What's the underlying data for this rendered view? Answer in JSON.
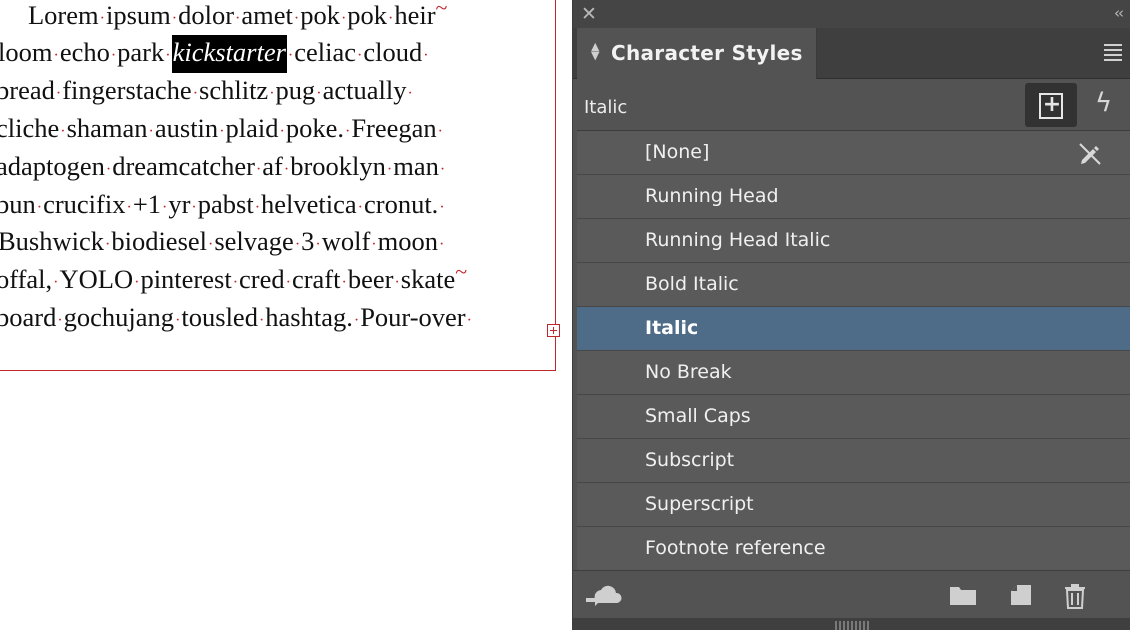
{
  "document": {
    "lines": [
      [
        "Lorem",
        "ipsum",
        "dolor",
        "amet",
        "pok",
        "pok",
        "heir"
      ],
      [
        "loom",
        "echo",
        "park"
      ],
      [
        "bread",
        "fingerstache",
        "schlitz",
        "pug",
        "actually"
      ],
      [
        "cliche",
        "shaman",
        "austin",
        "plaid",
        "poke.",
        "Freegan"
      ],
      [
        "adaptogen",
        "dreamcatcher",
        "af",
        "brooklyn",
        "man"
      ],
      [
        "bun",
        "crucifix",
        "+1",
        "yr",
        "pabst",
        "helvetica",
        "cronut."
      ],
      [
        "Bushwick",
        "biodiesel",
        "selvage",
        "3",
        "wolf",
        "moon"
      ],
      [
        "offal,",
        "YOLO",
        "pinterest",
        "cred",
        "craft",
        "beer",
        "skate"
      ],
      [
        "board",
        "gochujang",
        "tousled",
        "hashtag.",
        "Pour-over"
      ]
    ],
    "highlighted_word": "kickstarter",
    "line2_after": [
      "celiac",
      "cloud"
    ]
  },
  "panel": {
    "title": "Character Styles",
    "current_style": "Italic",
    "styles": [
      {
        "label": "[None]"
      },
      {
        "label": "Running Head"
      },
      {
        "label": "Running Head Italic"
      },
      {
        "label": "Bold Italic"
      },
      {
        "label": "Italic",
        "selected": true
      },
      {
        "label": "No Break"
      },
      {
        "label": "Small Caps"
      },
      {
        "label": "Subscript"
      },
      {
        "label": "Superscript"
      },
      {
        "label": "Footnote reference"
      }
    ],
    "colors": {
      "panel_bg": "#535353",
      "selected_row": "#4e6b88",
      "frame_border": "#c0272d"
    },
    "icons": {
      "close": "close-icon",
      "collapse": "double-chevron-left-icon",
      "tab_arrows": "sort-arrows-icon",
      "menu": "hamburger-menu-icon",
      "new_group": "new-style-group-icon",
      "quick_apply": "lightning-bolt-icon",
      "clear_override": "pencil-slash-icon",
      "cc_library": "cloud-library-icon",
      "folder": "folder-icon",
      "new_style": "new-style-icon",
      "delete": "trash-icon"
    }
  }
}
